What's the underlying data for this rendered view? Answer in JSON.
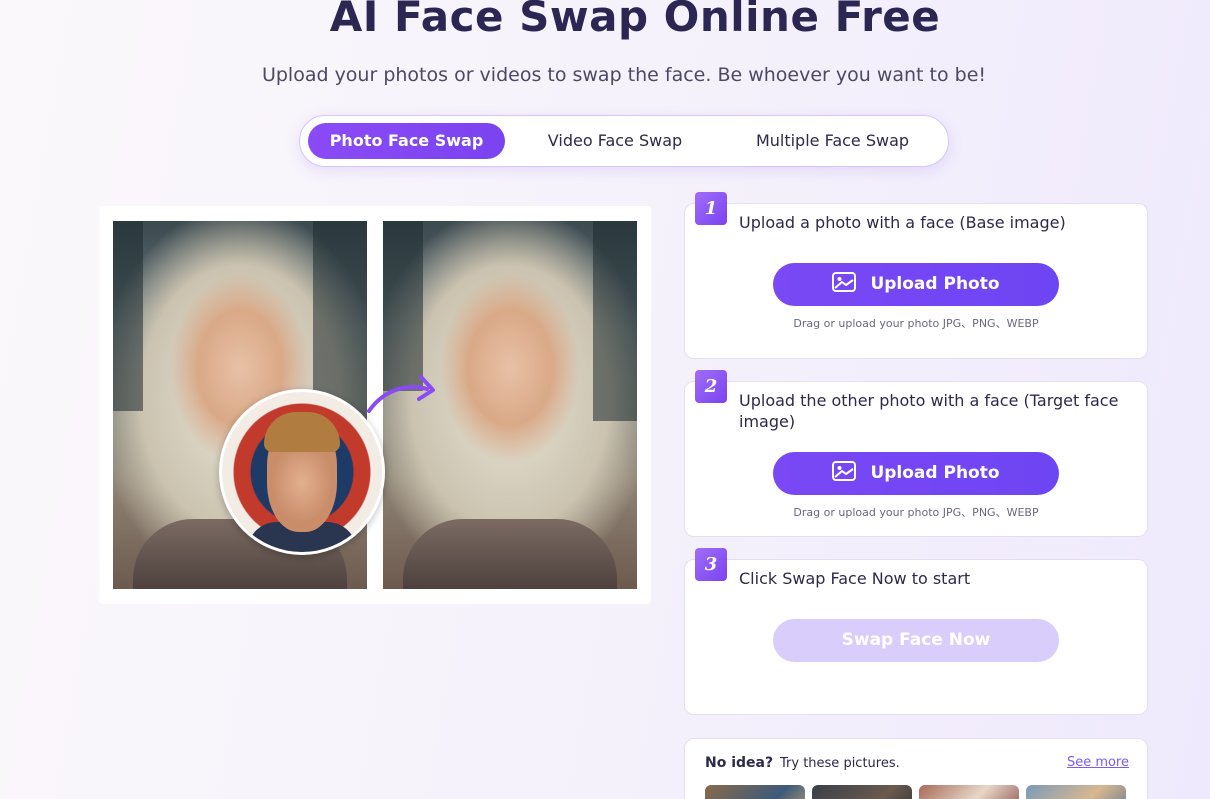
{
  "header": {
    "title": "AI Face Swap Online Free",
    "subtitle": "Upload your photos or videos to swap the face. Be whoever you want to be!"
  },
  "tabs": [
    {
      "label": "Photo Face Swap",
      "active": true
    },
    {
      "label": "Video Face Swap",
      "active": false
    },
    {
      "label": "Multiple Face Swap",
      "active": false
    }
  ],
  "steps": [
    {
      "number": "1",
      "text": "Upload a photo with a face (Base image)",
      "button_label": "Upload Photo",
      "hint": "Drag or upload your photo JPG、PNG、WEBP"
    },
    {
      "number": "2",
      "text": "Upload the other photo with a face (Target face image)",
      "button_label": "Upload Photo",
      "hint": "Drag or upload your photo JPG、PNG、WEBP"
    },
    {
      "number": "3",
      "text": "Click Swap Face Now to start",
      "button_label": "Swap Face Now"
    }
  ],
  "ideas": {
    "title": "No idea?",
    "subtitle": "Try these pictures.",
    "see_more": "See more"
  },
  "colors": {
    "accent": "#7b43f0",
    "title": "#2b2752",
    "disabled_button": "#d9cdfb"
  },
  "icons": {
    "upload": "image-icon",
    "arrow": "curved-arrow-icon"
  }
}
